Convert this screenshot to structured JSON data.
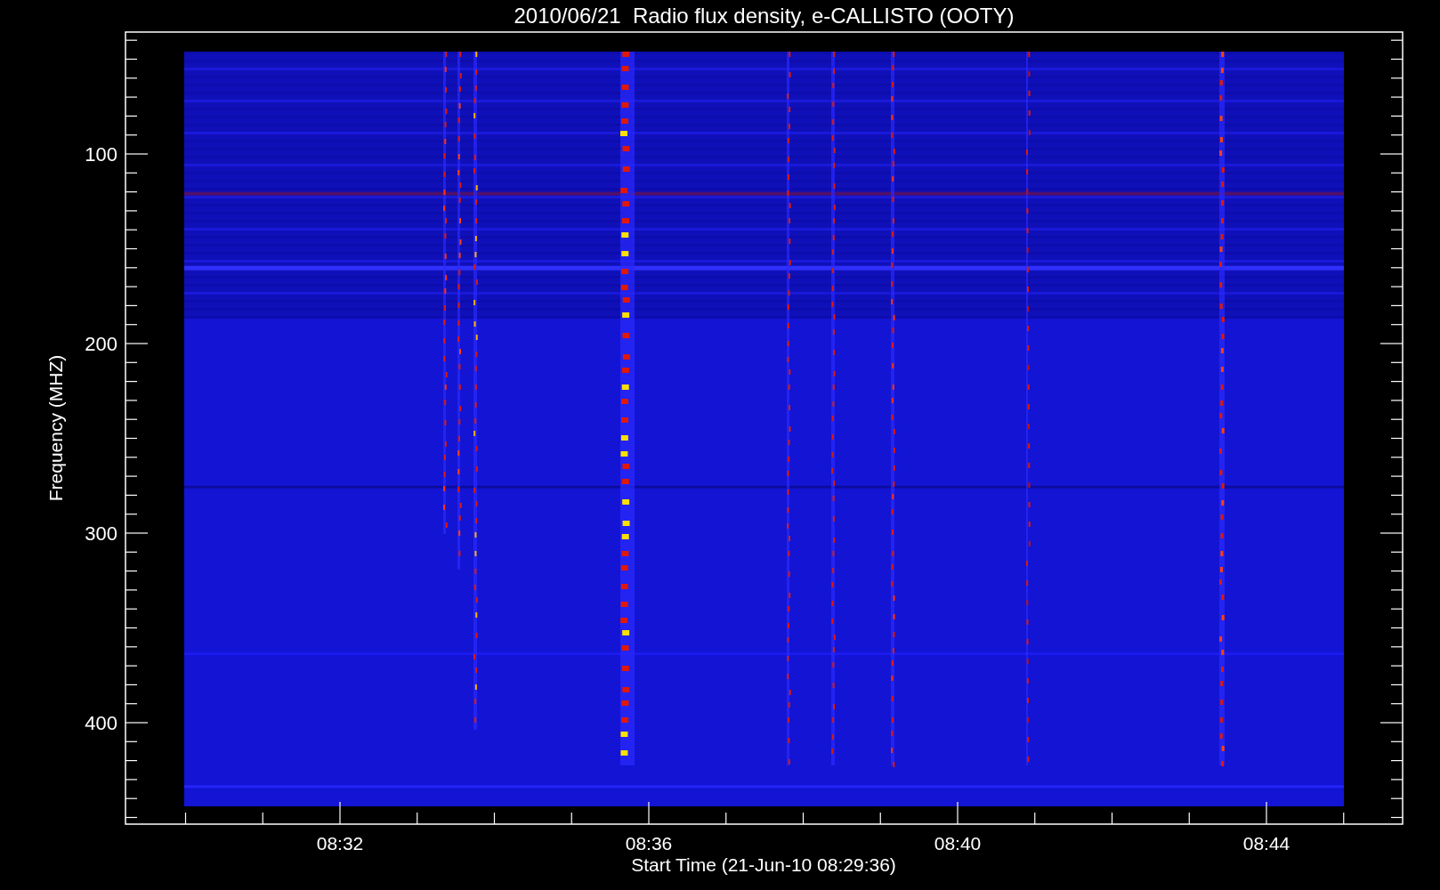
{
  "title": "2010/06/21  Radio flux density, e-CALLISTO (OOTY)",
  "y_axis": {
    "label": "Frequency (MHZ)",
    "ticks": [
      "100",
      "200",
      "300",
      "400"
    ]
  },
  "x_axis": {
    "label": "Start Time (21-Jun-10 08:29:36)",
    "ticks": [
      "08:32",
      "08:36",
      "08:40",
      "08:44"
    ]
  }
}
